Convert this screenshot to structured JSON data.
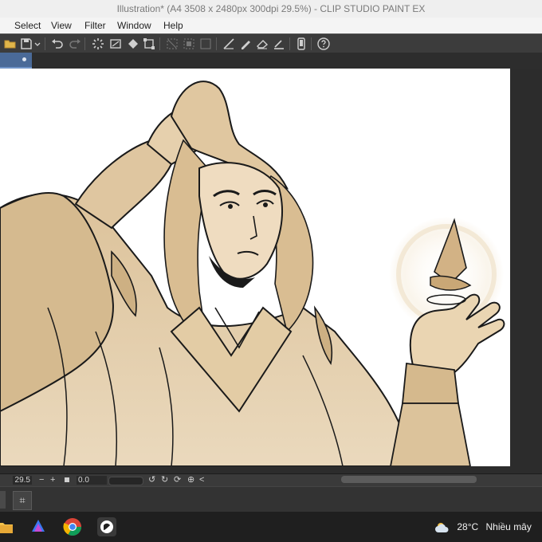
{
  "window": {
    "title": "Illustration* (A4 3508 x 2480px 300dpi 29.5%) - CLIP STUDIO PAINT EX"
  },
  "menu": {
    "items": [
      "Select",
      "View",
      "Filter",
      "Window",
      "Help"
    ]
  },
  "toolbar": {
    "icons": [
      "open-file",
      "save",
      "undo",
      "redo",
      "loading-spinner",
      "clear",
      "fill",
      "transform",
      "deselect",
      "invert-selection",
      "show-selection",
      "ruler",
      "pen",
      "eraser",
      "stroke",
      "device",
      "help"
    ]
  },
  "status": {
    "zoom": "29.5",
    "zoom_out": "−",
    "zoom_in": "+",
    "angle": "0.0",
    "rotate_left": "↺",
    "rotate_right": "↻",
    "reset_rotation": "⟳",
    "flip": "⊕",
    "scroll_arrow": "<"
  },
  "lower_panel": {
    "button_icon": "⌗"
  },
  "taskbar": {
    "apps": [
      "file-explorer",
      "copilot",
      "chrome",
      "clip-studio-paint"
    ],
    "weather": {
      "temperature": "28°C",
      "condition": "Nhiều mây"
    }
  },
  "colors": {
    "canvas_bg": "#ffffff",
    "line_art": "#1a1a1a",
    "tone": "#d8bf95",
    "accent_tab": "#4a6a98"
  }
}
